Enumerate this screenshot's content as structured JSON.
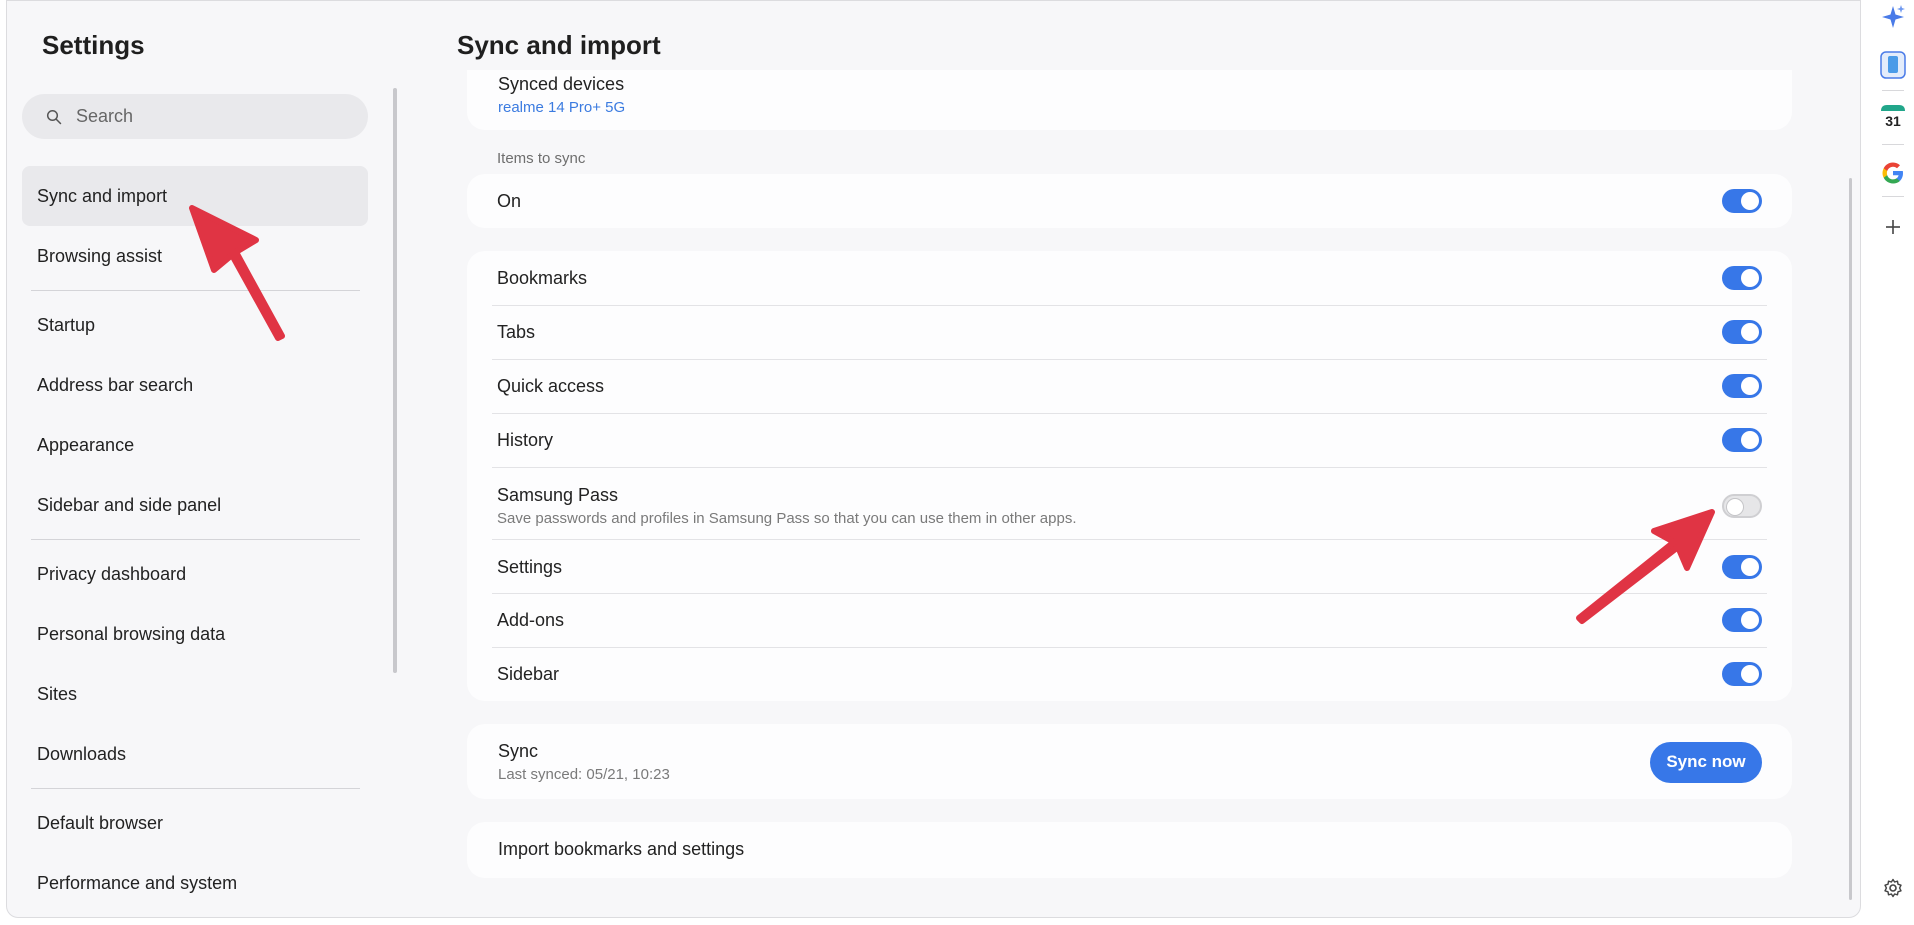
{
  "sidebar": {
    "title": "Settings",
    "search_placeholder": "Search",
    "items": [
      {
        "label": "Sync and import"
      },
      {
        "label": "Browsing assist"
      },
      {
        "label": "Startup"
      },
      {
        "label": "Address bar search"
      },
      {
        "label": "Appearance"
      },
      {
        "label": "Sidebar and side panel"
      },
      {
        "label": "Privacy dashboard"
      },
      {
        "label": "Personal browsing data"
      },
      {
        "label": "Sites"
      },
      {
        "label": "Downloads"
      },
      {
        "label": "Default browser"
      },
      {
        "label": "Performance and system"
      }
    ]
  },
  "main": {
    "title": "Sync and import",
    "synced_devices": {
      "label": "Synced devices",
      "device": "realme 14 Pro+ 5G"
    },
    "items_to_sync_label": "Items to sync",
    "on_row": {
      "label": "On",
      "enabled": true
    },
    "sync_items": [
      {
        "label": "Bookmarks",
        "enabled": true
      },
      {
        "label": "Tabs",
        "enabled": true
      },
      {
        "label": "Quick access",
        "enabled": true
      },
      {
        "label": "History",
        "enabled": true
      },
      {
        "label": "Samsung Pass",
        "description": "Save passwords and profiles in Samsung Pass so that you can use them in other apps.",
        "enabled": false
      },
      {
        "label": "Settings",
        "enabled": true
      },
      {
        "label": "Add-ons",
        "enabled": true
      },
      {
        "label": "Sidebar",
        "enabled": true
      }
    ],
    "sync": {
      "label": "Sync",
      "last_synced": "Last synced: 05/21, 10:23",
      "button": "Sync now"
    },
    "import_label": "Import bookmarks and settings"
  },
  "rail": {
    "icons": [
      "copilot-icon",
      "phone-icon",
      "calendar-icon",
      "google-icon",
      "add-icon",
      "settings-icon"
    ],
    "calendar_day": "31"
  },
  "colors": {
    "accent": "#3777e8",
    "annotation_arrow": "#e03444"
  }
}
